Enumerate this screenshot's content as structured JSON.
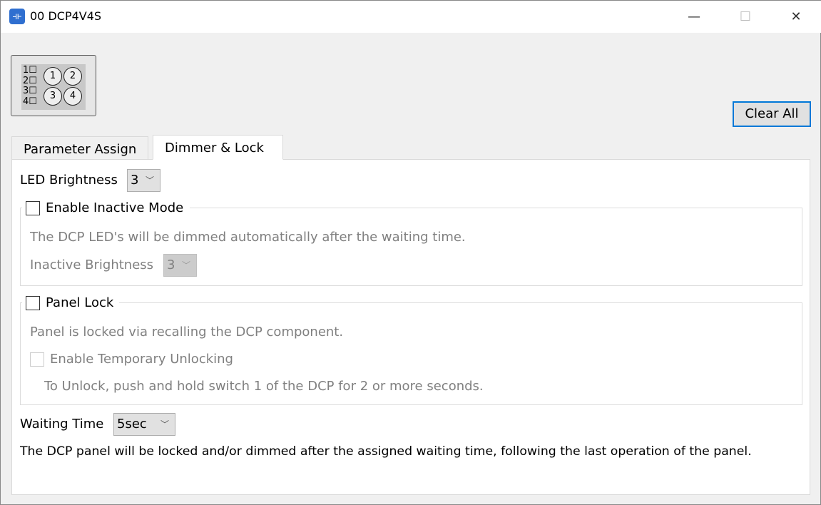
{
  "window": {
    "title": "00 DCP4V4S",
    "minimize": "—",
    "maximize": "☐",
    "close": "✕"
  },
  "panel_icon": {
    "leds": [
      "1",
      "2",
      "3",
      "4"
    ],
    "switches": [
      "1",
      "2",
      "3",
      "4"
    ]
  },
  "toolbar": {
    "clear_all": "Clear All"
  },
  "tabs": [
    {
      "label": "Parameter Assign",
      "active": false
    },
    {
      "label": "Dimmer & Lock",
      "active": true
    }
  ],
  "dimmer": {
    "led_brightness_label": "LED Brightness",
    "led_brightness_value": "3",
    "inactive": {
      "label": "Enable Inactive Mode",
      "checked": false,
      "description": "The DCP LED's will be dimmed automatically after the waiting time.",
      "brightness_label": "Inactive Brightness",
      "brightness_value": "3"
    },
    "lock": {
      "label": "Panel Lock",
      "checked": false,
      "description": "Panel is locked via recalling the DCP component.",
      "temp_unlock_label": "Enable Temporary Unlocking",
      "temp_unlock_checked": false,
      "temp_unlock_note": "To Unlock, push and hold switch 1 of the DCP for 2 or more seconds."
    },
    "waiting_time_label": "Waiting Time",
    "waiting_time_value": "5sec",
    "footer_note": "The DCP panel will be locked and/or dimmed after the assigned waiting time, following the last operation of the panel."
  },
  "colors": {
    "accent": "#0078d7",
    "app_icon": "#2f6fd0"
  }
}
